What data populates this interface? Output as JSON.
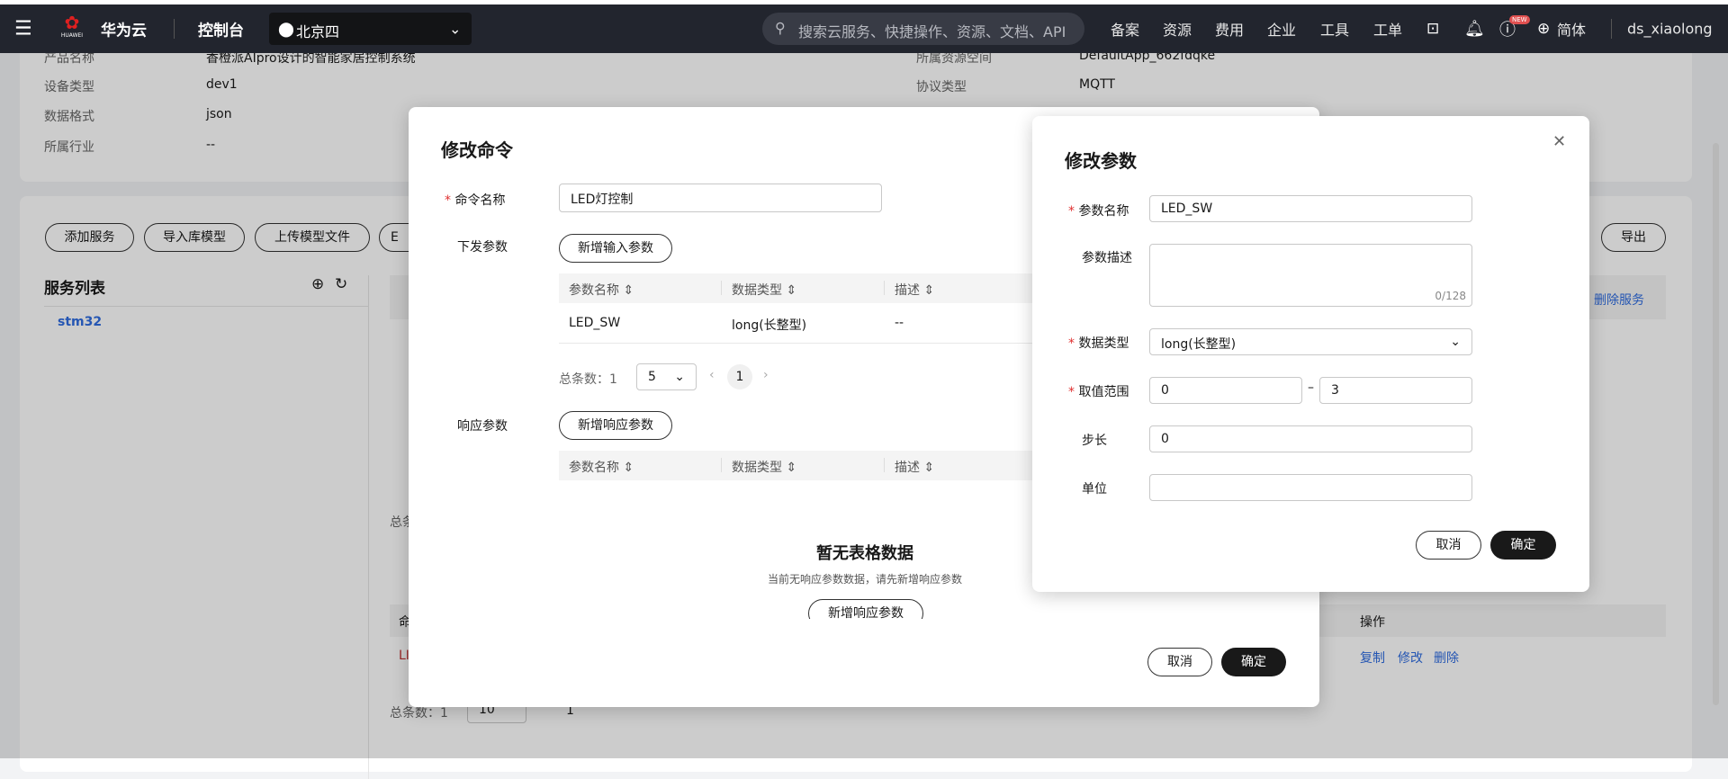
{
  "topbar": {
    "brand": "华为云",
    "logo_text": "HUAWEI",
    "console": "控制台",
    "region": "北京四",
    "search_placeholder": "搜索云服务、快捷操作、资源、文档、API",
    "nav": [
      "备案",
      "资源",
      "费用",
      "企业",
      "工具",
      "工单"
    ],
    "new_badge": "NEW",
    "language": "简体",
    "user": "ds_xiaolong"
  },
  "product_info": {
    "rows": [
      {
        "label": "产品名称",
        "value": "香橙派AIpro设计的智能家居控制系统"
      },
      {
        "label": "设备类型",
        "value": "dev1"
      },
      {
        "label": "数据格式",
        "value": "json"
      },
      {
        "label": "所属行业",
        "value": "--"
      }
    ],
    "right_rows": [
      {
        "label": "所属资源空间",
        "value": "DefaultApp_662fdqke"
      },
      {
        "label": "协议类型",
        "value": "MQTT"
      }
    ]
  },
  "toolbar": {
    "buttons": [
      "添加服务",
      "导入库模型",
      "上传模型文件",
      "E"
    ],
    "export": "导出"
  },
  "service_list": {
    "title": "服务列表",
    "items": [
      "stm32"
    ],
    "delete_service": "删除服务"
  },
  "bg_table": {
    "total": "总条数：1",
    "page_size": "10",
    "page": "1",
    "row_prefix": "LI",
    "header_prefix": "命",
    "ops_header": "操作",
    "actions": [
      "复制",
      "修改",
      "删除"
    ],
    "total_mid": "总条"
  },
  "cmd_modal": {
    "title": "修改命令",
    "name_label": "命令名称",
    "name_value": "LED灯控制",
    "down_label": "下发参数",
    "add_input": "新增输入参数",
    "columns": [
      "参数名称",
      "数据类型",
      "描述"
    ],
    "rows": [
      [
        "LED_SW",
        "long(长整型)",
        "--"
      ]
    ],
    "total": "总条数：1",
    "page_size": "5",
    "page": "1",
    "resp_label": "响应参数",
    "add_resp": "新增响应参数",
    "empty_title": "暂无表格数据",
    "empty_desc": "当前无响应参数数据，请先新增响应参数",
    "empty_button": "新增响应参数",
    "cancel": "取消",
    "ok": "确定"
  },
  "param_modal": {
    "title": "修改参数",
    "name_label": "参数名称",
    "name_value": "LED_SW",
    "desc_label": "参数描述",
    "desc_value": "",
    "desc_count": "0/128",
    "type_label": "数据类型",
    "type_value": "long(长整型)",
    "range_label": "取值范围",
    "range_min": "0",
    "range_max": "3",
    "step_label": "步长",
    "step_value": "0",
    "unit_label": "单位",
    "unit_value": "",
    "cancel": "取消",
    "ok": "确定"
  }
}
